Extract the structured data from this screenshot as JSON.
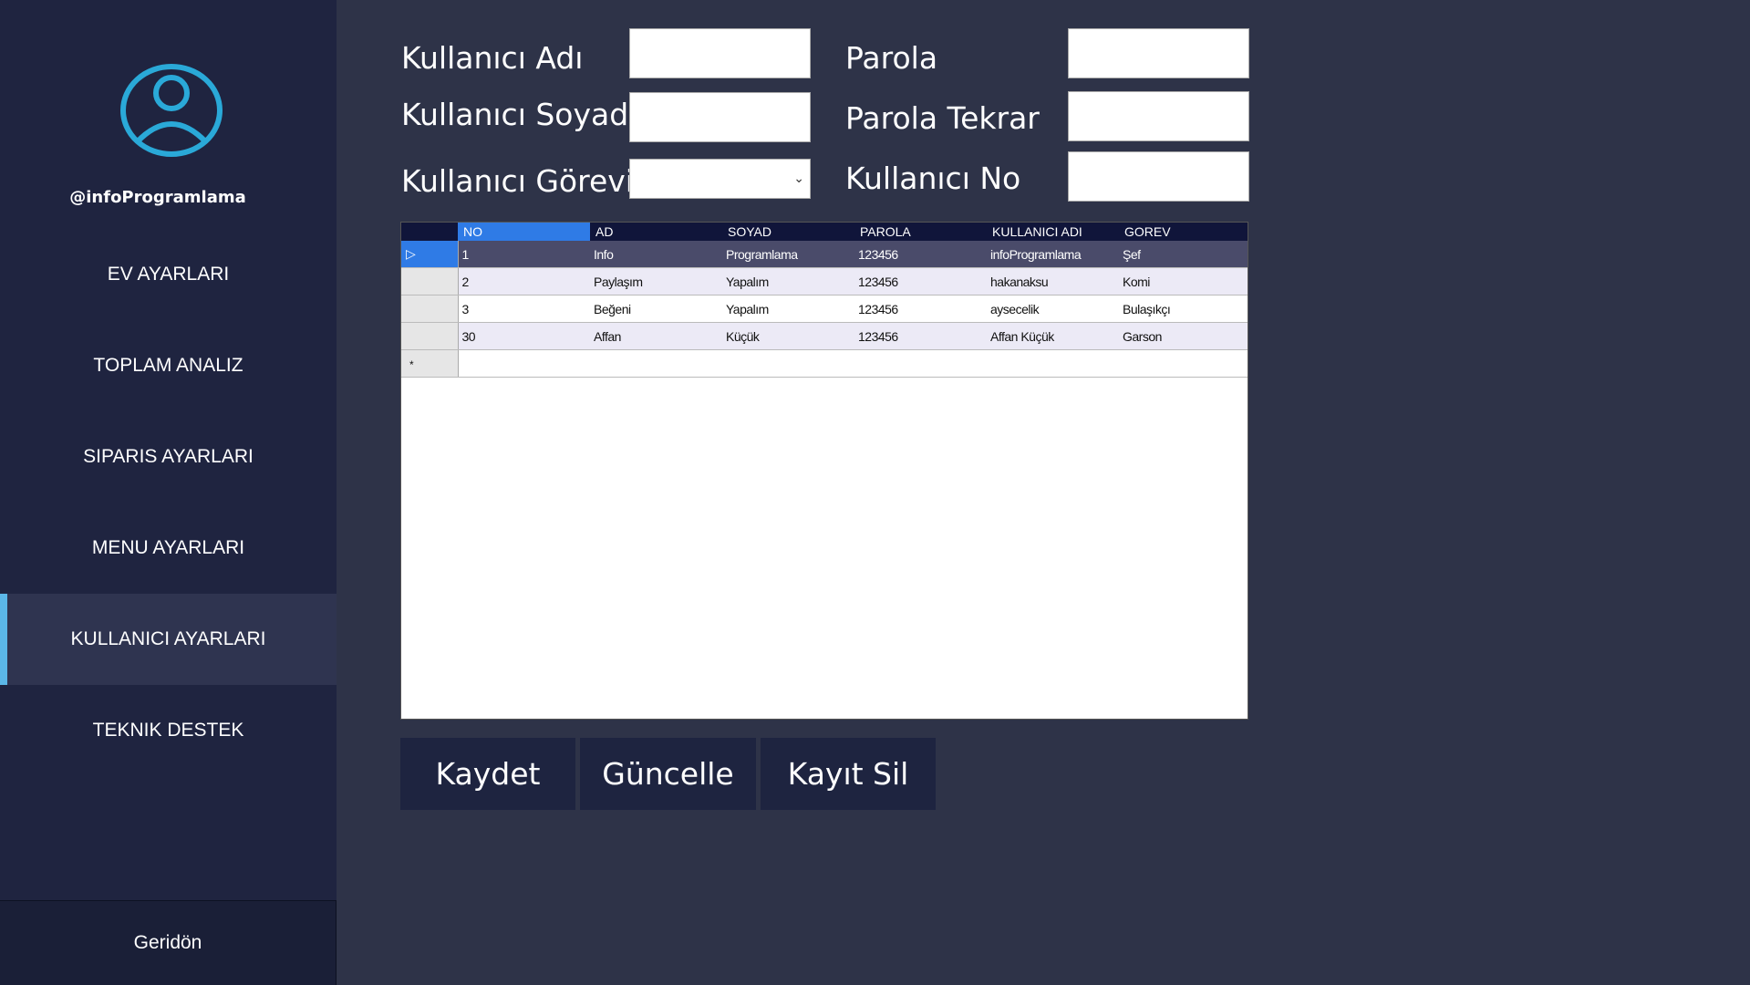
{
  "sidebar": {
    "username": "@infoProgramlama",
    "items": [
      {
        "label": "EV AYARLARI"
      },
      {
        "label": "TOPLAM ANALIZ"
      },
      {
        "label": "SIPARIS AYARLARI"
      },
      {
        "label": "MENU AYARLARI"
      },
      {
        "label": "KULLANICI AYARLARI"
      },
      {
        "label": "TEKNIK DESTEK"
      }
    ],
    "back_label": "Geridön",
    "accent_color": "#5bb7e8"
  },
  "form": {
    "first_name_label": "Kullanıcı Adı",
    "first_name_value": "",
    "last_name_label": "Kullanıcı Soyadı",
    "last_name_value": "",
    "role_label": "Kullanıcı Görevi",
    "role_value": "",
    "password_label": "Parola",
    "password_value": "",
    "password_repeat_label": "Parola Tekrar",
    "password_repeat_value": "",
    "user_no_label": "Kullanıcı No",
    "user_no_value": ""
  },
  "grid": {
    "columns": [
      "NO",
      "AD",
      "SOYAD",
      "PAROLA",
      "KULLANICI ADI",
      "GOREV"
    ],
    "rows": [
      [
        "1",
        "Info",
        "Programlama",
        "123456",
        "infoProgramlama",
        "Şef"
      ],
      [
        "2",
        "Paylaşım",
        "Yapalım",
        "123456",
        "hakanaksu",
        "Komi"
      ],
      [
        "3",
        "Beğeni",
        "Yapalım",
        "123456",
        "aysecelik",
        "Bulaşıkçı"
      ],
      [
        "30",
        "Affan",
        "Küçük",
        "123456",
        "Affan Küçük",
        "Garson"
      ]
    ],
    "new_row_marker": "*",
    "current_row_marker": "▷"
  },
  "buttons": {
    "save": "Kaydet",
    "update": "Güncelle",
    "delete": "Kayıt Sil"
  }
}
